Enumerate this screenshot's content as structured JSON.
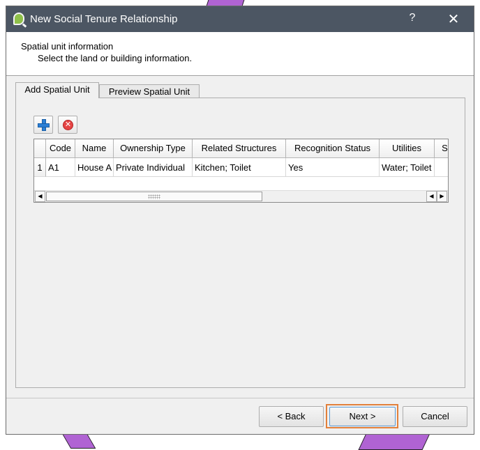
{
  "window": {
    "title": "New Social Tenure Relationship",
    "help_label": "?",
    "close_label": "✕"
  },
  "header": {
    "title": "Spatial unit information",
    "subtitle": "Select the land or building information."
  },
  "tabs": [
    {
      "label": "Add Spatial Unit",
      "active": true
    },
    {
      "label": "Preview Spatial Unit",
      "active": false
    }
  ],
  "toolbar": {
    "add_icon": "plus-icon",
    "remove_icon": "remove-circle-icon",
    "remove_glyph": "✕"
  },
  "table": {
    "columns": [
      "Code",
      "Name",
      "Ownership Type",
      "Related Structures",
      "Recognition Status",
      "Utilities",
      "S"
    ],
    "rows": [
      {
        "num": "1",
        "cells": [
          "A1",
          "House A",
          "Private Individual",
          "Kitchen; Toilet",
          "Yes",
          "Water; Toilet",
          ""
        ]
      }
    ]
  },
  "scrollbar": {
    "left_arrow": "◀",
    "right_arrow": "▶"
  },
  "buttons": {
    "back": "< Back",
    "next": "Next >",
    "cancel": "Cancel"
  },
  "colors": {
    "titlebar": "#4c5663",
    "highlight_outline": "#e2803b",
    "background_shape": "#b063d3"
  }
}
